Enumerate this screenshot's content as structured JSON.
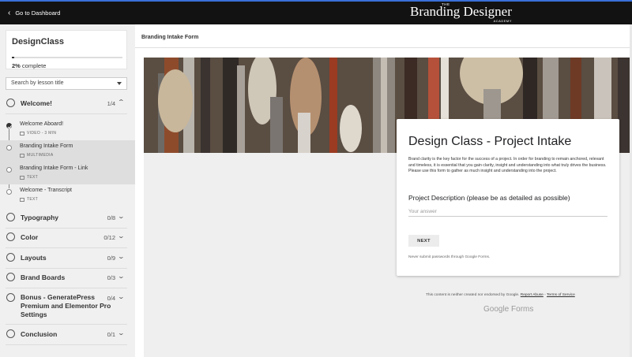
{
  "topbar": {
    "back_label": "Go to Dashboard",
    "brand_the": "THE",
    "brand_name": "Branding Designer",
    "brand_academy": "ACADEMY"
  },
  "course": {
    "title": "DesignClass",
    "progress_percent": 2,
    "progress_pct_label": "2%",
    "progress_suffix": " complete"
  },
  "search": {
    "placeholder": "Search by lesson title"
  },
  "sections": [
    {
      "name": "Welcome!",
      "count": "1/4",
      "expanded": true
    },
    {
      "name": "Typography",
      "count": "0/8"
    },
    {
      "name": "Color",
      "count": "0/12"
    },
    {
      "name": "Layouts",
      "count": "0/9"
    },
    {
      "name": "Brand Boards",
      "count": "0/3"
    },
    {
      "name_line1": "Bonus - GeneratePress",
      "name_line2": "Premium and Elementor Pro",
      "name_line3": "Settings",
      "count": "0/4"
    },
    {
      "name": "Conclusion",
      "count": "0/1"
    }
  ],
  "lessons": [
    {
      "title": "Welcome Aboard!",
      "meta": "VIDEO - 3 MIN",
      "completed": true
    },
    {
      "title": "Branding Intake Form",
      "meta": "MULTIMEDIA",
      "active": true
    },
    {
      "title": "Branding Intake Form - Link",
      "meta": "TEXT"
    },
    {
      "title": "Welcome - Transcript",
      "meta": "TEXT"
    }
  ],
  "main": {
    "header_title": "Branding Intake Form"
  },
  "form": {
    "title": "Design Class - Project Intake",
    "description": "Brand clarity is the key factor for the success of a project. In order for branding to remain anchored, relevant and timeless, it is essential that you gain clarity, insight and understanding into what truly drives the business. Please use this form to gather as much insight and understanding into the project.",
    "question": "Project Description (please be as detailed as possible)",
    "answer_placeholder": "Your answer",
    "next_label": "NEXT",
    "warning": "Never submit passwords through Google Forms."
  },
  "footer": {
    "notice": "This content is neither created nor endorsed by Google.",
    "report_link": "Report Abuse",
    "separator": " - ",
    "terms_link": "Terms of Service",
    "logo_google": "Google",
    "logo_forms": " Forms"
  },
  "colors": {
    "topbar": "#121212",
    "accent_border": "#3a6fd8",
    "active_lesson": "#dedede"
  }
}
